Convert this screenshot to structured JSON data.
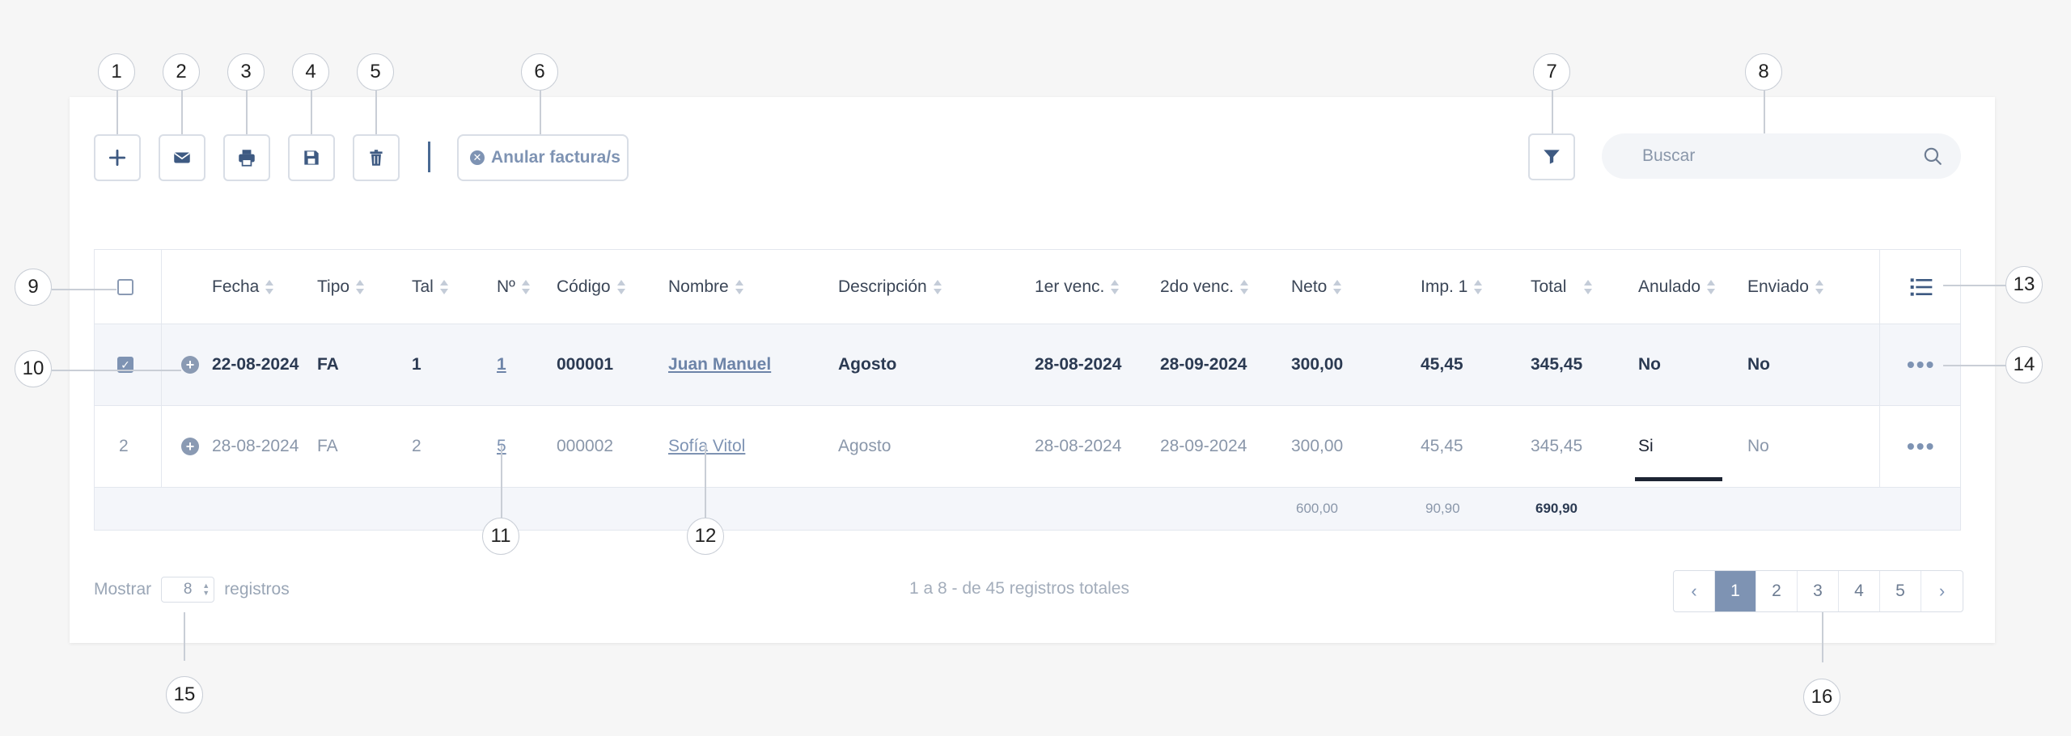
{
  "toolbar": {
    "buttons": [
      {
        "name": "add",
        "icon": "plus-icon"
      },
      {
        "name": "email",
        "icon": "envelope-icon"
      },
      {
        "name": "print",
        "icon": "printer-icon"
      },
      {
        "name": "save",
        "icon": "floppy-disk-icon"
      },
      {
        "name": "delete",
        "icon": "trash-icon"
      }
    ],
    "anular_label": "Anular factura/s",
    "filter_icon": "filter-icon",
    "search_placeholder": "Buscar"
  },
  "table": {
    "columns": [
      "Fecha",
      "Tipo",
      "Tal",
      "Nº",
      "Código",
      "Nombre",
      "Descripción",
      "1er venc.",
      "2do venc.",
      "Neto",
      "Imp. 1",
      "Total",
      "Anulado",
      "Enviado"
    ],
    "rows": [
      {
        "index": "",
        "selected": true,
        "fecha": "22-08-2024",
        "tipo": "FA",
        "tal": "1",
        "numero": "1",
        "codigo": "000001",
        "nombre": "Juan Manuel",
        "descripcion": "Agosto",
        "venc1": "28-08-2024",
        "venc2": "28-09-2024",
        "neto": "300,00",
        "imp1": "45,45",
        "total": "345,45",
        "anulado": "No",
        "enviado": "No"
      },
      {
        "index": "2",
        "selected": false,
        "fecha": "28-08-2024",
        "tipo": "FA",
        "tal": "2",
        "numero": "5",
        "codigo": "000002",
        "nombre": "Sofía Vitol",
        "descripcion": "Agosto",
        "venc1": "28-08-2024",
        "venc2": "28-09-2024",
        "neto": "300,00",
        "imp1": "45,45",
        "total": "345,45",
        "anulado": "Si",
        "enviado": "No"
      }
    ],
    "totals": {
      "neto": "600,00",
      "imp1": "90,90",
      "total": "690,90"
    }
  },
  "footer": {
    "mostrar": "Mostrar",
    "per_page": "8",
    "registros": "registros",
    "summary": "1 a 8 - de 45 registros totales",
    "pages": [
      "1",
      "2",
      "3",
      "4",
      "5"
    ],
    "active_page": "1",
    "prev": "‹",
    "next": "›"
  },
  "callouts": [
    "1",
    "2",
    "3",
    "4",
    "5",
    "6",
    "7",
    "8",
    "9",
    "10",
    "11",
    "12",
    "13",
    "14",
    "15",
    "16"
  ]
}
